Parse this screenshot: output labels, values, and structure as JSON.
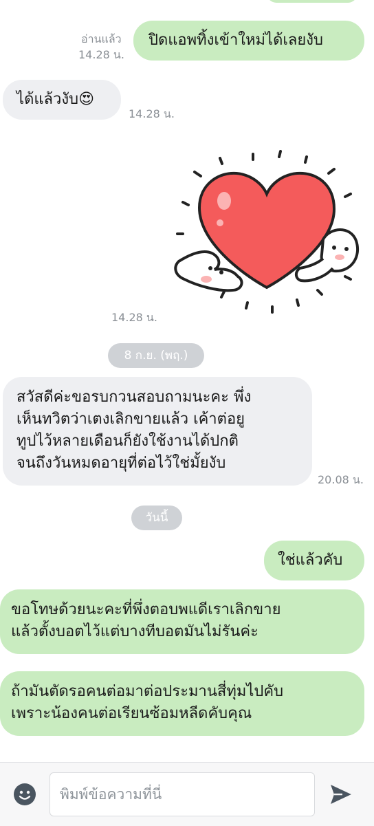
{
  "messages": {
    "m1": {
      "text": "ปิดแอพทิ้งเข้าใหม่ได้เลยงับ",
      "read": "อ่านแล้ว",
      "time": "14.28 น."
    },
    "m2": {
      "text": "ได้แล้วงับ",
      "emoji": "😍",
      "time": "14.28 น."
    },
    "m3": {
      "sticker": "heart-hug-sticker",
      "time": "14.28 น."
    },
    "m4": {
      "lines": [
        "สวัสดีค่ะขอรบกวนสอบถามนะคะ พึ่ง",
        "เห็นทวิตว่าเตงเลิกขายแล้ว เค้าต่อยู",
        "ทูปไว้หลายเดือนก็ยังใช้งานได้ปกติ",
        "จนถึงวันหมดอายุที่ต่อไว้ใช่มั้ยงับ"
      ],
      "time": "20.08 น."
    },
    "m5": {
      "text": "ใช่แล้วคับ"
    },
    "m6": {
      "lines": [
        "ขอโทษด้วยนะคะที่พึ่งตอบพแดีเราเลิกขาย",
        "แล้วตั้งบอตไว้แต่บางทีบอตมันไม่รันค่ะ"
      ]
    },
    "m7": {
      "lines": [
        "ถ้ามันตัดรอคนต่อมาต่อประมานสี่ทุ่มไปคับ",
        "เพราะน้องคนต่อเรียนซ้อมหลีดคับคุณ"
      ]
    }
  },
  "dates": {
    "d1": "8 ก.ย. (พฤ.)",
    "d2": "วันนี้"
  },
  "compose": {
    "placeholder": "พิมพ์ข้อความที่นี่",
    "emoji_icon": "smiley-icon",
    "send_icon": "send-icon"
  },
  "colors": {
    "outgoing": "#c9ecc0",
    "incoming": "#eeeff2",
    "heart": "#f45b5b"
  }
}
